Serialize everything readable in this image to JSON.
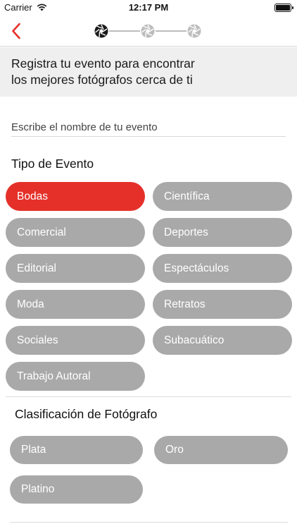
{
  "status_bar": {
    "carrier": "Carrier",
    "time": "12:17 PM",
    "battery_level": 1.0
  },
  "colors": {
    "accent": "#e5302a",
    "pill_default": "#a9a9a9",
    "banner_bg": "#efefef"
  },
  "nav": {
    "back_icon": "chevron-left-icon",
    "steps": {
      "total": 3,
      "current": 1,
      "icon": "camera-aperture-icon"
    }
  },
  "intro": {
    "line1": "Registra tu evento para encontrar",
    "line2": "los mejores fotógrafos cerca de ti"
  },
  "event_name": {
    "placeholder": "Escribe el nombre de tu evento",
    "value": ""
  },
  "event_type": {
    "title": "Tipo de Evento",
    "options": [
      {
        "label": "Bodas",
        "selected": true
      },
      {
        "label": "Científica",
        "selected": false
      },
      {
        "label": "Comercial",
        "selected": false
      },
      {
        "label": "Deportes",
        "selected": false
      },
      {
        "label": "Editorial",
        "selected": false
      },
      {
        "label": "Espectáculos",
        "selected": false
      },
      {
        "label": "Moda",
        "selected": false
      },
      {
        "label": "Retratos",
        "selected": false
      },
      {
        "label": "Sociales",
        "selected": false
      },
      {
        "label": "Subacuático",
        "selected": false
      },
      {
        "label": "Trabajo Autoral",
        "selected": false
      }
    ]
  },
  "photographer_class": {
    "title": "Clasificación de Fotógrafo",
    "options": [
      {
        "label": "Plata",
        "selected": false
      },
      {
        "label": "Oro",
        "selected": false
      },
      {
        "label": "Platino",
        "selected": false
      }
    ]
  }
}
